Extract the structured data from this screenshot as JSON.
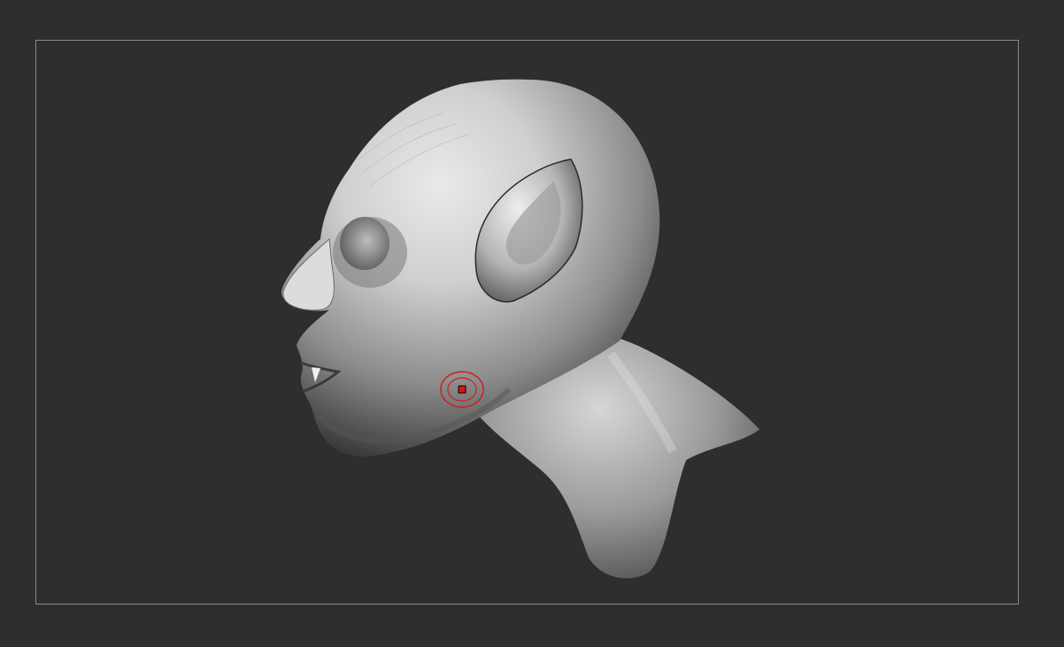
{
  "app": {
    "canvas_background": "#2e2e2e",
    "frame_border_color": "#8a8a8a"
  },
  "model": {
    "subject": "creature-head-sculpt",
    "material_color": "#bdbdbd"
  },
  "brush_cursor": {
    "icon": "brush-draw-size-icon",
    "ring_color": "#cc1f1f",
    "center_color": "#e01010"
  }
}
